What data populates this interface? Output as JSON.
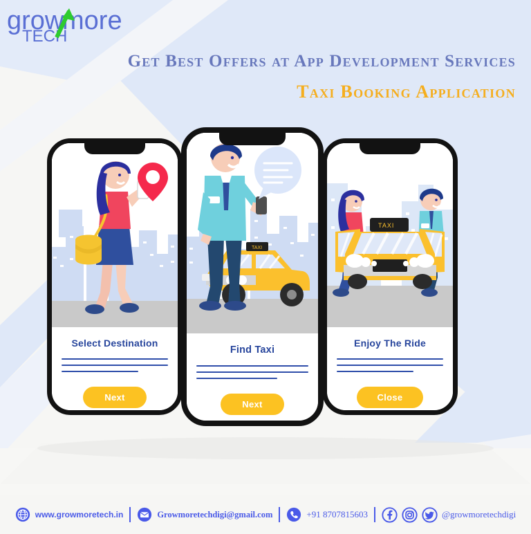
{
  "brand": {
    "logo_text_main": "growmore",
    "logo_text_sub": "TECH",
    "logo_color": "#5a6fd4",
    "logo_arrow_color": "#2ecc2e"
  },
  "headline": {
    "line1": "Get Best Offers at App Development Services",
    "line2": "Taxi Booking Application",
    "line1_color": "#6878bc",
    "line2_color": "#f5ae1e"
  },
  "phones": [
    {
      "id": "select-destination",
      "caption": "Select Destination",
      "button_label": "Next",
      "illustration": "woman-with-bag-holding-phone-map-pin",
      "line_count": 3
    },
    {
      "id": "find-taxi",
      "caption": "Find Taxi",
      "button_label": "Next",
      "illustration": "man-with-phone-chat-bubble-and-taxi",
      "line_count": 3
    },
    {
      "id": "enjoy-the-ride",
      "caption": "Enjoy The Ride",
      "button_label": "Close",
      "illustration": "taxi-front-view-with-two-passengers",
      "line_count": 3
    }
  ],
  "theme": {
    "accent_yellow": "#fcc222",
    "caption_blue": "#27459c",
    "rule_blue": "#2f4eaa",
    "footer_blue": "#4a5ae8",
    "background": "#f6f6f4",
    "band_blue": "#dde6f7"
  },
  "footer": {
    "website": "www.growmoretech.in",
    "email": "Growmoretechdigi@gmail.com",
    "phone": "+91 8707815603",
    "social_handle": "@growmoretechdigi",
    "icons": {
      "globe": "globe-icon",
      "mail": "envelope-icon",
      "call": "phone-icon",
      "facebook": "facebook-icon",
      "instagram": "instagram-icon",
      "twitter": "twitter-icon"
    }
  }
}
